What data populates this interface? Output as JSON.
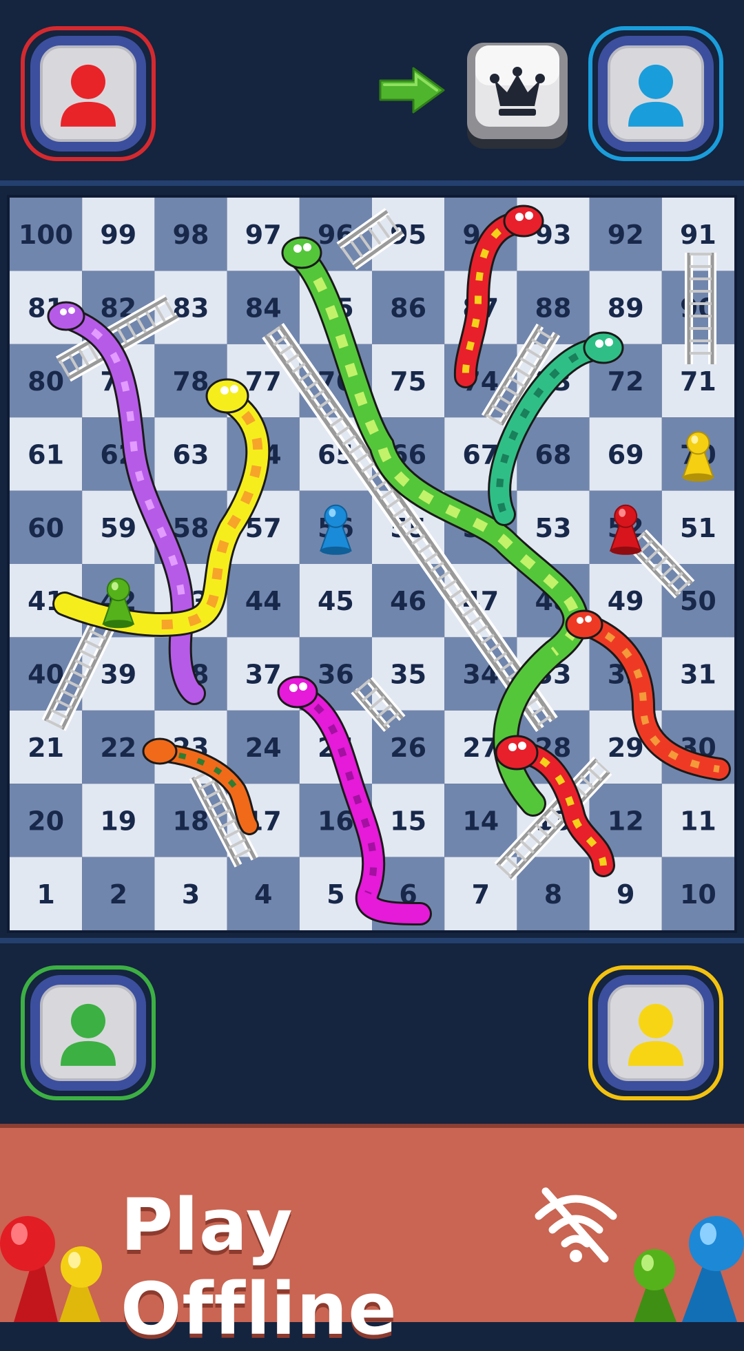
{
  "players": {
    "top_left": {
      "color": "#e82429",
      "ring": "#d42a2f"
    },
    "top_right": {
      "color": "#1a9ddb",
      "ring": "#1a9ddb"
    },
    "bottom_left": {
      "color": "#3cb043",
      "ring": "#3cb043"
    },
    "bottom_right": {
      "color": "#f7d514",
      "ring": "#f2c20f"
    }
  },
  "turn_indicator": {
    "arrow_color": "#4fb52c",
    "icon": "crown-icon"
  },
  "board": {
    "rows": [
      [
        100,
        99,
        98,
        97,
        96,
        95,
        94,
        93,
        92,
        91
      ],
      [
        81,
        82,
        83,
        84,
        85,
        86,
        87,
        88,
        89,
        90
      ],
      [
        80,
        79,
        78,
        77,
        76,
        75,
        74,
        73,
        72,
        71
      ],
      [
        61,
        62,
        63,
        64,
        65,
        66,
        67,
        68,
        69,
        70
      ],
      [
        60,
        59,
        58,
        57,
        56,
        55,
        54,
        53,
        52,
        51
      ],
      [
        41,
        42,
        43,
        44,
        45,
        46,
        47,
        48,
        49,
        50
      ],
      [
        40,
        39,
        38,
        37,
        36,
        35,
        34,
        33,
        32,
        31
      ],
      [
        21,
        22,
        23,
        24,
        25,
        26,
        27,
        28,
        29,
        30
      ],
      [
        20,
        19,
        18,
        17,
        16,
        15,
        14,
        13,
        12,
        11
      ],
      [
        1,
        2,
        3,
        4,
        5,
        6,
        7,
        8,
        9,
        10
      ]
    ],
    "light_color": "#e2e8f2",
    "dark_color": "#7186ad",
    "number_color": "#18284a"
  },
  "pieces": [
    {
      "color": "blue",
      "square": 56
    },
    {
      "color": "red",
      "square": 52
    },
    {
      "color": "yellow",
      "square": 70
    },
    {
      "color": "green",
      "square": 42
    }
  ],
  "banner": {
    "title": "Play Offline",
    "icon": "wifi-off-icon",
    "background": "#c96552"
  }
}
